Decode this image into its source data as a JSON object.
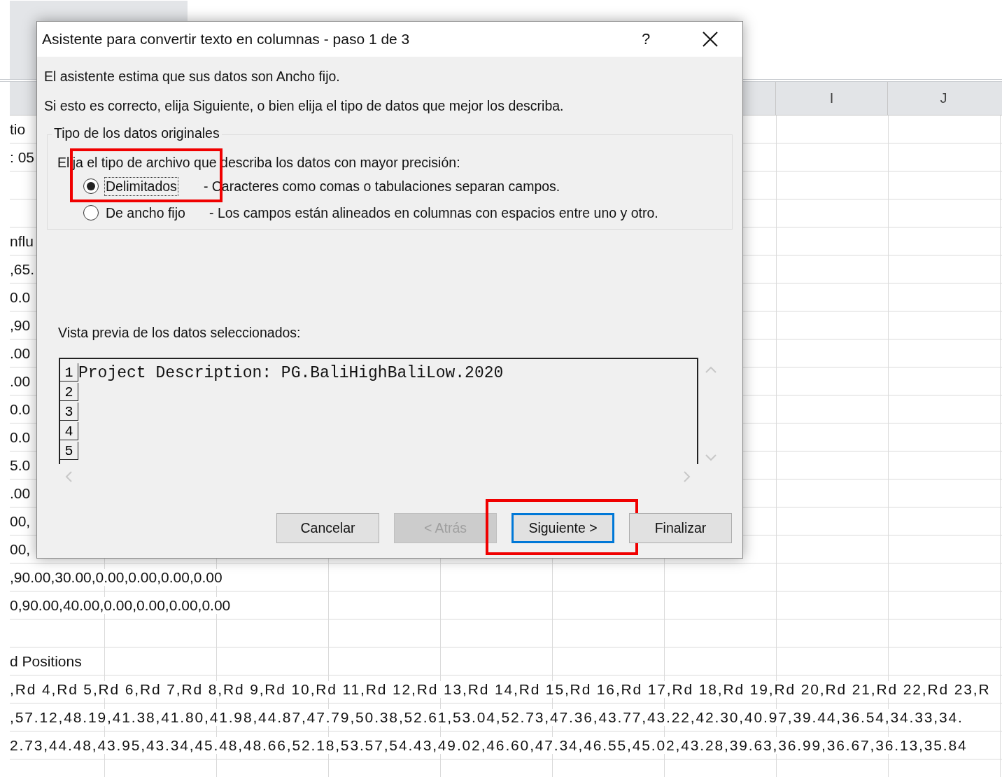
{
  "sheet": {
    "column_headers": [
      "I",
      "J"
    ],
    "rows": [
      {
        "text": "tio"
      },
      {
        "text": ": 05"
      },
      {},
      {},
      {
        "text": "nflu"
      },
      {
        "text": ",65."
      },
      {
        "text": "0.0"
      },
      {
        "text": ",90"
      },
      {
        "text": ".00"
      },
      {
        "text": ".00"
      },
      {
        "text": "0.0"
      },
      {
        "text": "0.0"
      },
      {
        "text": "5.0"
      },
      {
        "text": ".00"
      },
      {
        "text": "00,"
      },
      {
        "text": "00,"
      },
      {
        "text": ",90.00,30.00,0.00,0.00,0.00,0.00"
      },
      {
        "text": "0,90.00,40.00,0.00,0.00,0.00,0.00"
      },
      {},
      {
        "text": "d Positions"
      },
      {
        "text": ",Rd 4,Rd 5,Rd 6,Rd 7,Rd 8,Rd 9,Rd 10,Rd 11,Rd 12,Rd 13,Rd 14,Rd 15,Rd 16,Rd 17,Rd 18,Rd 19,Rd 20,Rd 21,Rd 22,Rd 23,R"
      },
      {
        "text": ",57.12,48.19,41.38,41.80,41.98,44.87,47.79,50.38,52.61,53.04,52.73,47.36,43.77,43.22,42.30,40.97,39.44,36.54,34.33,34."
      },
      {
        "text": "2.73,44.48,43.95,43.34,45.48,48.66,52.18,53.57,54.43,49.02,46.60,47.34,46.55,45.02,43.28,39.63,36.99,36.67,36.13,35.84"
      },
      {}
    ]
  },
  "dialog": {
    "title": "Asistente para convertir texto en columnas - paso 1 de 3",
    "help": "?",
    "intro": [
      "El asistente estima que sus datos son Ancho fijo.",
      "Si esto es correcto, elija Siguiente, o bien elija el tipo de datos que mejor los describa."
    ],
    "group": {
      "legend": "Tipo de los datos originales",
      "prompt": "Elija el tipo de archivo que describa los datos con mayor precisión:",
      "options": [
        {
          "label": "Delimitados",
          "description": "- Caracteres como comas o tabulaciones separan campos.",
          "selected": true,
          "focused": true,
          "highlighted": true
        },
        {
          "label": "De ancho fijo",
          "description": "- Los campos están alineados en columnas con espacios entre uno y otro.",
          "selected": false,
          "focused": false,
          "highlighted": false
        }
      ]
    },
    "preview": {
      "label": "Vista previa de los datos seleccionados:",
      "lines": [
        {
          "number": "1",
          "text": "Project Description: PG.BaliHighBaliLow.2020"
        },
        {
          "number": "2"
        },
        {
          "number": "3"
        },
        {
          "number": "4"
        },
        {
          "number": "5"
        }
      ]
    },
    "buttons": [
      {
        "label": "Cancelar",
        "disabled": false,
        "default": false,
        "highlighted": false
      },
      {
        "label": "< Atrás",
        "disabled": true,
        "default": false,
        "highlighted": false
      },
      {
        "label": "Siguiente >",
        "disabled": false,
        "default": true,
        "highlighted": true
      },
      {
        "label": "Finalizar",
        "disabled": false,
        "default": false,
        "highlighted": false
      }
    ]
  }
}
